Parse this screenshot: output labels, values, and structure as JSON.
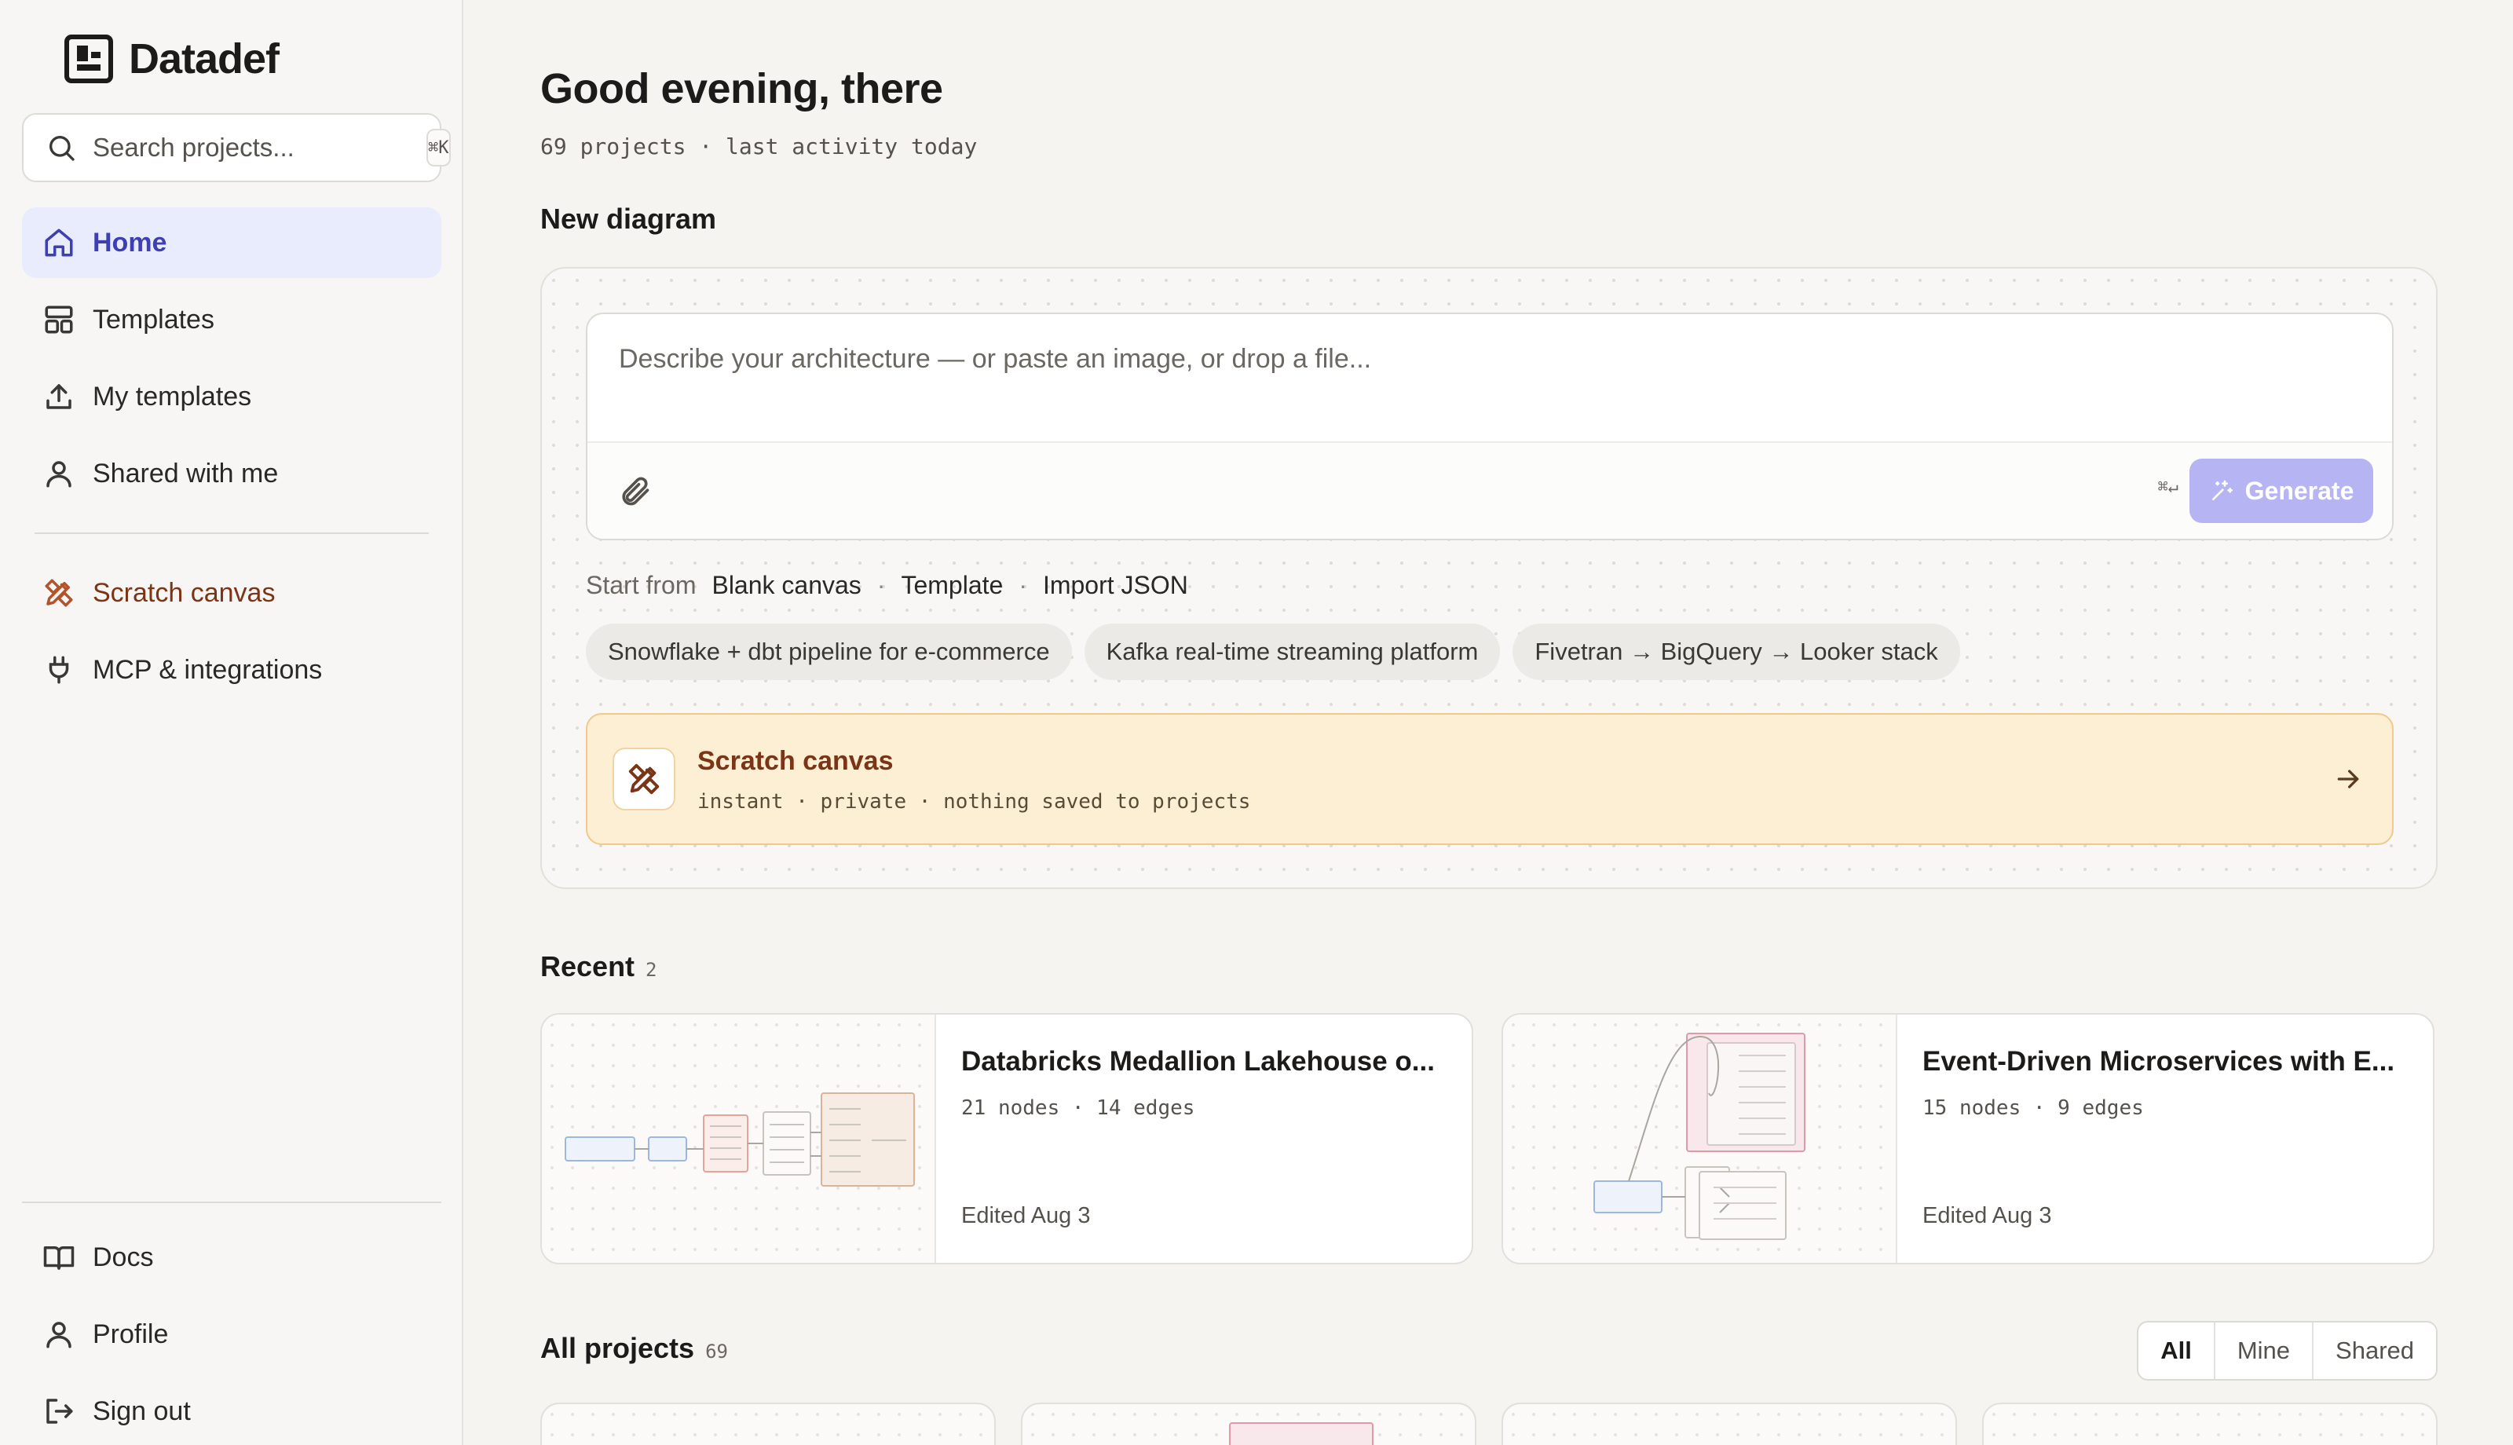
{
  "app": {
    "name": "Datadef"
  },
  "search": {
    "placeholder": "Search projects...",
    "shortcut": "⌘K"
  },
  "nav": {
    "primary": [
      {
        "label": "Home",
        "icon": "home-icon",
        "active": true
      },
      {
        "label": "Templates",
        "icon": "layout-icon"
      },
      {
        "label": "My templates",
        "icon": "upload-icon"
      },
      {
        "label": "Shared with me",
        "icon": "user-icon"
      }
    ],
    "tools": [
      {
        "label": "Scratch canvas",
        "icon": "pencil-ruler-icon"
      },
      {
        "label": "MCP & integrations",
        "icon": "plug-icon"
      }
    ],
    "footer": [
      {
        "label": "Docs",
        "icon": "book-icon"
      },
      {
        "label": "Profile",
        "icon": "user-icon"
      },
      {
        "label": "Sign out",
        "icon": "sign-out-icon"
      }
    ]
  },
  "header": {
    "greeting": "Good evening, there",
    "meta": "69 projects · last activity today"
  },
  "new_diagram": {
    "title": "New diagram",
    "prompt_placeholder": "Describe your architecture — or paste an image, or drop a file...",
    "enter_hint": "⌘↵",
    "generate_label": "Generate",
    "start_from_label": "Start from",
    "start_options": [
      "Blank canvas",
      "Template",
      "Import JSON"
    ],
    "separator": "·",
    "suggestions": [
      "Snowflake + dbt pipeline for e-commerce",
      "Kafka real-time streaming platform",
      "Fivetran → BigQuery → Looker stack"
    ],
    "scratch": {
      "title": "Scratch canvas",
      "subtitle": "instant · private · nothing saved to projects"
    }
  },
  "recent": {
    "title": "Recent",
    "count": "2",
    "items": [
      {
        "title": "Databricks Medallion Lakehouse o...",
        "meta": "21 nodes · 14 edges",
        "edited": "Edited Aug 3"
      },
      {
        "title": "Event-Driven Microservices with E...",
        "meta": "15 nodes · 9 edges",
        "edited": "Edited Aug 3"
      }
    ]
  },
  "all_projects": {
    "title": "All projects",
    "count": "69",
    "filters": [
      {
        "label": "All",
        "active": true
      },
      {
        "label": "Mine"
      },
      {
        "label": "Shared"
      }
    ]
  },
  "colors": {
    "accent": "#3d3fb3",
    "active_nav_bg": "#e8ecfd",
    "generate_bg": "#b7b4f4",
    "scratch_bg": "#fdefd3",
    "scratch_text": "#7c3416"
  }
}
